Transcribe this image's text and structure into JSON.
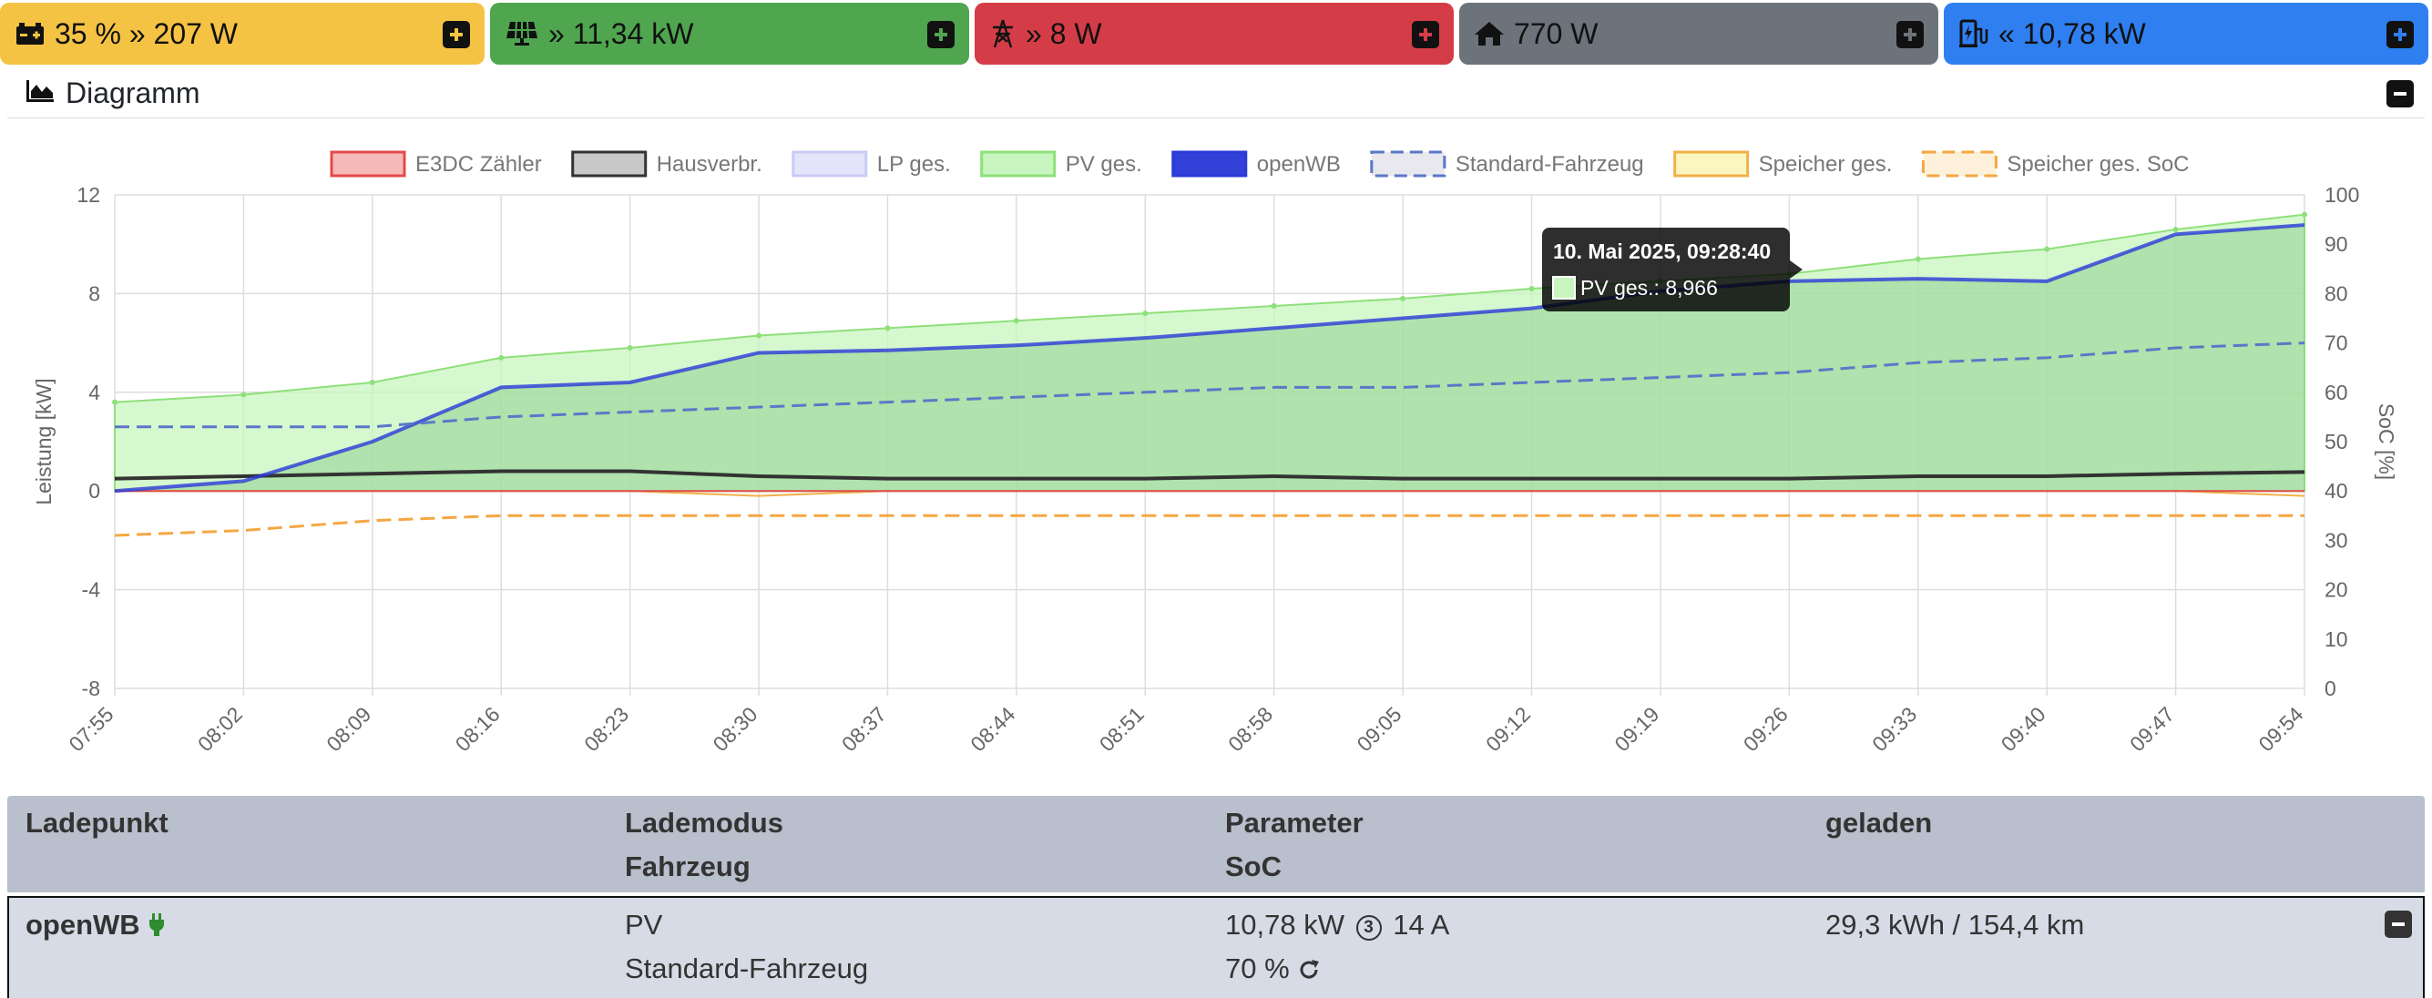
{
  "topbar": {
    "battery": {
      "text": "35 % » 207 W",
      "color": "#f5c344"
    },
    "pv": {
      "text": "» 11,34 kW",
      "color": "#4fa64f"
    },
    "grid": {
      "text": "» 8 W",
      "color": "#d43d48"
    },
    "house": {
      "text": "770 W",
      "color": "#6d737a"
    },
    "charging": {
      "text": "« 10,78 kW",
      "color": "#2f7ff0"
    }
  },
  "chart_card": {
    "title": "Diagramm"
  },
  "chart_data": {
    "type": "line",
    "x": [
      "07:55",
      "08:02",
      "08:09",
      "08:16",
      "08:23",
      "08:30",
      "08:37",
      "08:44",
      "08:51",
      "08:58",
      "09:05",
      "09:12",
      "09:19",
      "09:26",
      "09:33",
      "09:40",
      "09:47",
      "09:54"
    ],
    "xlabel": "",
    "ylabel": "Leistung [kW]",
    "ylim": [
      -8,
      12
    ],
    "yticks": [
      12,
      8,
      4,
      0,
      -4,
      -8
    ],
    "y2label": "SoC [%]",
    "y2lim": [
      0,
      100
    ],
    "y2ticks": [
      100,
      90,
      80,
      70,
      60,
      50,
      40,
      30,
      20,
      10,
      0
    ],
    "grid": true,
    "legend_position": "top",
    "series": [
      {
        "name": "E3DC Zähler",
        "color": "#e24b4b",
        "fill": "#f6b9b9",
        "style": "area"
      },
      {
        "name": "Hausverbr.",
        "color": "#333333",
        "fill": "#c8c8c8",
        "style": "line"
      },
      {
        "name": "LP ges.",
        "color": "#c9cbf5",
        "fill": "#e4e4fb",
        "style": "area"
      },
      {
        "name": "PV ges.",
        "color": "#8ee07a",
        "fill": "#c8f5bf",
        "style": "area"
      },
      {
        "name": "openWB",
        "color": "#2a39d8",
        "fill": "#3340d8",
        "style": "line"
      },
      {
        "name": "Standard-Fahrzeug",
        "color": "#5a78c8",
        "fill": "#e8e8ee",
        "style": "dashed"
      },
      {
        "name": "Speicher ges.",
        "color": "#f0b14a",
        "fill": "#fbf6bf",
        "style": "area"
      },
      {
        "name": "Speicher ges. SoC",
        "color": "#f5a742",
        "fill": "#fdf1dc",
        "style": "dashed"
      }
    ],
    "series_values": {
      "PV ges.": [
        3.6,
        3.9,
        4.4,
        5.4,
        5.8,
        6.3,
        6.6,
        6.9,
        7.2,
        7.5,
        7.8,
        8.2,
        8.5,
        8.8,
        9.4,
        9.8,
        10.6,
        11.2
      ],
      "openWB": [
        0,
        0.4,
        2.0,
        4.2,
        4.4,
        5.6,
        5.7,
        5.9,
        6.2,
        6.6,
        7.0,
        7.4,
        8.1,
        8.5,
        8.6,
        8.5,
        10.4,
        10.78
      ],
      "Hausverbr.": [
        0.5,
        0.6,
        0.7,
        0.8,
        0.8,
        0.6,
        0.5,
        0.5,
        0.5,
        0.6,
        0.5,
        0.5,
        0.5,
        0.5,
        0.6,
        0.6,
        0.7,
        0.77
      ],
      "E3DC Zähler": [
        0,
        0,
        0,
        0,
        0,
        0,
        0,
        0,
        0,
        0,
        0,
        0,
        0,
        0,
        0,
        0,
        0,
        0
      ],
      "Speicher ges.": [
        0,
        0,
        0,
        0,
        0,
        -0.2,
        0,
        0,
        0,
        0,
        0,
        0,
        0,
        0,
        0,
        0,
        0,
        -0.2
      ],
      "Standard-Fahrzeug": [
        53,
        53,
        53,
        55,
        56,
        57,
        58,
        59,
        60,
        61,
        61,
        62,
        63,
        64,
        66,
        67,
        69,
        70
      ],
      "Speicher ges. SoC": [
        31,
        32,
        34,
        35,
        35,
        35,
        35,
        35,
        35,
        35,
        35,
        35,
        35,
        35,
        35,
        35,
        35,
        35
      ]
    },
    "tooltip": {
      "title": "10. Mai 2025, 09:28:40",
      "label": "PV ges.: 8,966"
    }
  },
  "table": {
    "headers": {
      "col1": "Ladepunkt",
      "col2a": "Lademodus",
      "col2b": "Fahrzeug",
      "col3a": "Parameter",
      "col3b": "SoC",
      "col4": "geladen"
    },
    "row": {
      "name": "openWB",
      "mode": "PV",
      "vehicle": "Standard-Fahrzeug",
      "power": "10,78 kW",
      "phases": "3",
      "current": "14 A",
      "soc": "70 %",
      "charged": "29,3 kWh / 154,4 km"
    }
  }
}
